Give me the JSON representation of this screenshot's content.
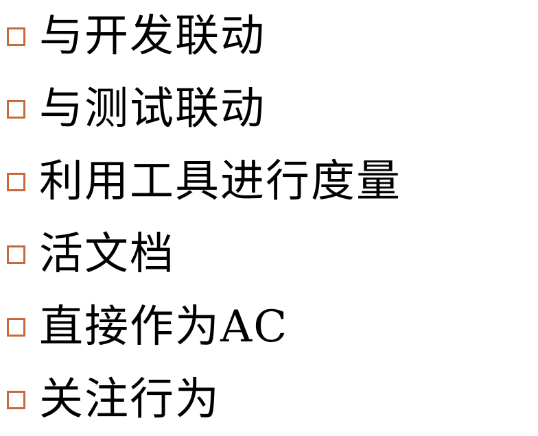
{
  "slide": {
    "bullet_color": "#c8693a",
    "text_color": "#000000",
    "items": [
      {
        "text": "与开发联动"
      },
      {
        "text": "与测试联动"
      },
      {
        "text": "利用工具进行度量"
      },
      {
        "text": "活文档"
      },
      {
        "text": "直接作为AC"
      },
      {
        "text": "关注行为"
      }
    ]
  }
}
